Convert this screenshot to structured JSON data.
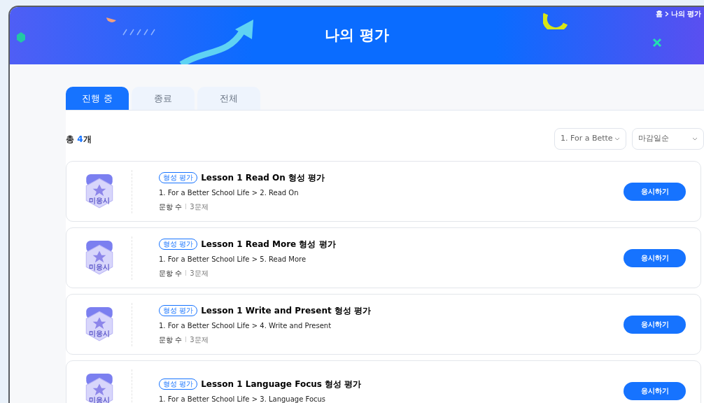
{
  "header": {
    "title": "나의 평가",
    "breadcrumb": [
      "홈",
      "나의 평가"
    ]
  },
  "tabs": [
    {
      "label": "진행 중",
      "selected": true
    },
    {
      "label": "종료",
      "selected": false
    },
    {
      "label": "전체",
      "selected": false
    }
  ],
  "total": {
    "prefix": "총 ",
    "count": "4",
    "suffix": "개"
  },
  "filters": [
    {
      "value": "1. For a Bette"
    },
    {
      "value": "마감일순"
    }
  ],
  "items": [
    {
      "status": "미응시",
      "tag": "형성 평가",
      "title": "Lesson 1 Read On 형성 평가",
      "path": "1. For a Better School Life > 2. Read On",
      "meta_label": "문항 수",
      "meta_value": "3문제",
      "button": "응시하기"
    },
    {
      "status": "미응시",
      "tag": "형성 평가",
      "title": "Lesson 1 Read More 형성 평가",
      "path": "1. For a Better School Life > 5. Read More",
      "meta_label": "문항 수",
      "meta_value": "3문제",
      "button": "응시하기"
    },
    {
      "status": "미응시",
      "tag": "형성 평가",
      "title": "Lesson 1 Write and Present 형성 평가",
      "path": "1. For a Better School Life > 4. Write and Present",
      "meta_label": "문항 수",
      "meta_value": "3문제",
      "button": "응시하기"
    },
    {
      "status": "미응시",
      "tag": "형성 평가",
      "title": "Lesson 1 Language Focus 형성 평가",
      "path": "1. For a Better School Life > 3. Language Focus",
      "button": "응시하기"
    }
  ]
}
